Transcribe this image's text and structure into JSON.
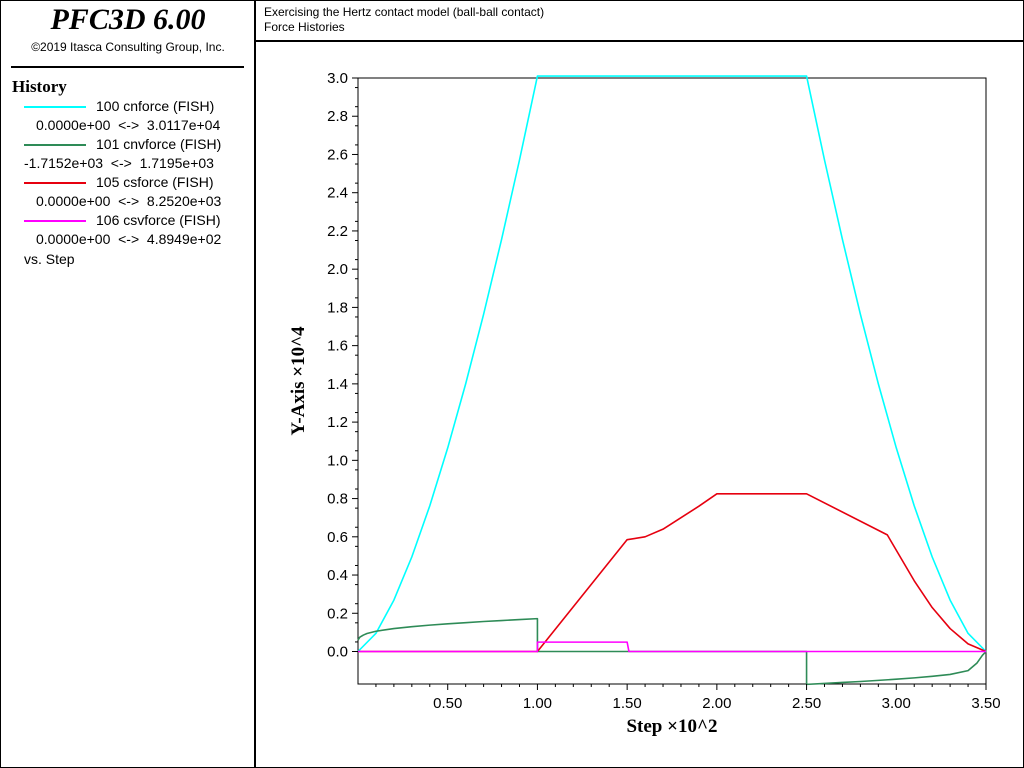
{
  "app": {
    "title": "PFC3D 6.00",
    "copyright": "©2019 Itasca Consulting Group, Inc."
  },
  "header": {
    "line1": "Exercising the Hertz contact model (ball-ball contact)",
    "line2": "Force Histories"
  },
  "legend": {
    "heading": "History",
    "entries": [
      {
        "label": "100 cnforce (FISH)",
        "range": "0.0000e+00  <->  3.0117e+04",
        "color": "#00ffff"
      },
      {
        "label": "101 cnvforce (FISH)",
        "range": "-1.7152e+03  <->  1.7195e+03",
        "color": "#2e8b57"
      },
      {
        "label": "105 csforce (FISH)",
        "range": "0.0000e+00  <->  8.2520e+03",
        "color": "#e6000f"
      },
      {
        "label": "106 csvforce (FISH)",
        "range": "0.0000e+00  <->  4.8949e+02",
        "color": "#ff00ff"
      }
    ],
    "vs": "vs. Step"
  },
  "chart_data": {
    "type": "line",
    "xlabel": "Step ×10^2",
    "ylabel": "Y-Axis ×10^4",
    "xlim": [
      0,
      3.5
    ],
    "ylim": [
      -0.17,
      3.0
    ],
    "xticks": [
      0.5,
      1.0,
      1.5,
      2.0,
      2.5,
      3.0,
      3.5
    ],
    "xtick_labels": [
      "0.50",
      "1.00",
      "1.50",
      "2.00",
      "2.50",
      "3.00",
      "3.50"
    ],
    "yticks": [
      0.0,
      0.2,
      0.4,
      0.6,
      0.8,
      1.0,
      1.2,
      1.4,
      1.6,
      1.8,
      2.0,
      2.2,
      2.4,
      2.6,
      2.8,
      3.0
    ],
    "ytick_labels": [
      "0.0",
      "0.2",
      "0.4",
      "0.6",
      "0.8",
      "1.0",
      "1.2",
      "1.4",
      "1.6",
      "1.8",
      "2.0",
      "2.2",
      "2.4",
      "2.6",
      "2.8",
      "3.0"
    ],
    "grid": false,
    "series": [
      {
        "name": "100 cnforce (FISH)",
        "color": "#00ffff",
        "x": [
          0,
          0.1,
          0.2,
          0.3,
          0.4,
          0.5,
          0.6,
          0.7,
          0.8,
          0.9,
          1.0,
          2.5,
          2.6,
          2.7,
          2.8,
          2.9,
          3.0,
          3.1,
          3.2,
          3.3,
          3.4,
          3.5
        ],
        "y": [
          0,
          0.095,
          0.269,
          0.495,
          0.762,
          1.065,
          1.4,
          1.764,
          2.155,
          2.571,
          3.01,
          3.01,
          2.571,
          2.155,
          1.764,
          1.4,
          1.065,
          0.762,
          0.495,
          0.269,
          0.095,
          0
        ]
      },
      {
        "name": "101 cnvforce (FISH)",
        "color": "#2e8b57",
        "x": [
          0,
          0.01,
          0.03,
          0.05,
          0.1,
          0.2,
          0.3,
          0.4,
          0.5,
          0.6,
          0.7,
          0.8,
          0.9,
          1.0,
          1.0,
          1.5,
          2.5,
          2.5,
          2.6,
          2.7,
          2.8,
          2.9,
          3.0,
          3.1,
          3.2,
          3.3,
          3.4,
          3.45,
          3.48,
          3.5
        ],
        "y": [
          0.06,
          0.075,
          0.086,
          0.094,
          0.106,
          0.12,
          0.13,
          0.138,
          0.145,
          0.151,
          0.157,
          0.162,
          0.167,
          0.172,
          0,
          0,
          0,
          -0.172,
          -0.167,
          -0.162,
          -0.157,
          -0.151,
          -0.145,
          -0.138,
          -0.13,
          -0.12,
          -0.1,
          -0.06,
          -0.02,
          0
        ]
      },
      {
        "name": "105 csforce (FISH)",
        "color": "#e6000f",
        "x": [
          0,
          1.0,
          1.5,
          1.6,
          1.7,
          1.8,
          1.9,
          2.0,
          2.5,
          2.95,
          3.1,
          3.2,
          3.3,
          3.4,
          3.5
        ],
        "y": [
          0,
          0,
          0.585,
          0.6,
          0.64,
          0.7,
          0.76,
          0.825,
          0.825,
          0.61,
          0.37,
          0.23,
          0.12,
          0.04,
          0
        ]
      },
      {
        "name": "106 csvforce (FISH)",
        "color": "#ff00ff",
        "x": [
          0,
          1.0,
          1.0,
          1.5,
          1.51,
          3.5
        ],
        "y": [
          0,
          0,
          0.049,
          0.049,
          0,
          0
        ]
      }
    ]
  }
}
